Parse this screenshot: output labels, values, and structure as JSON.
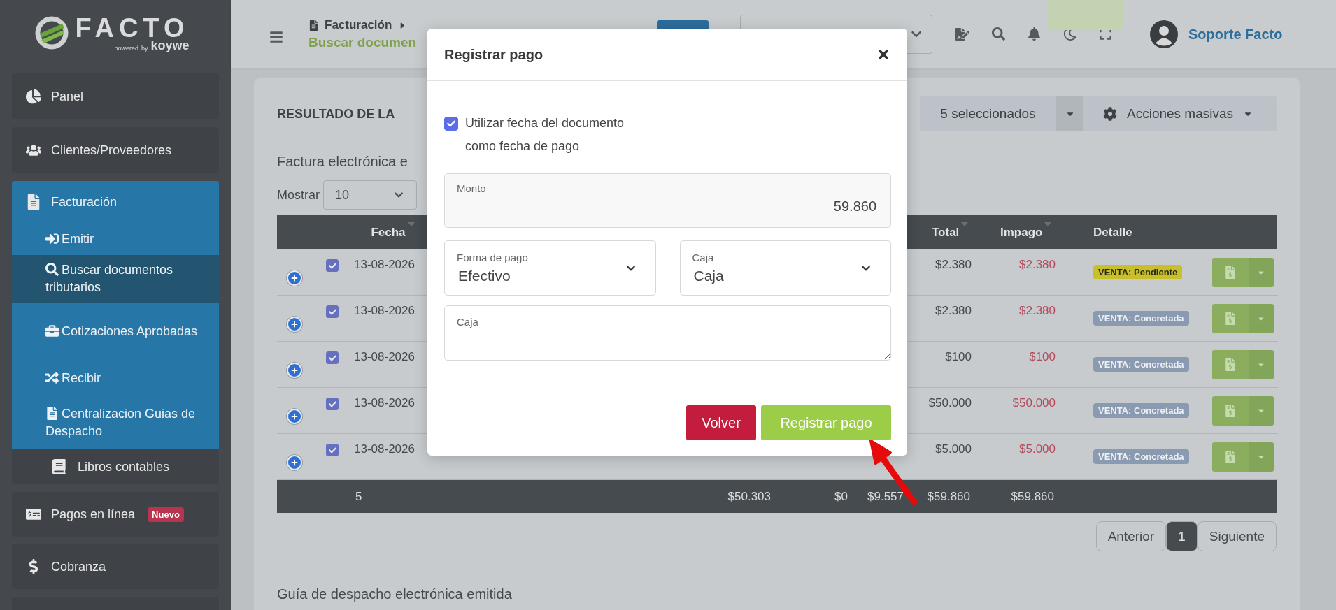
{
  "sidebar": {
    "logo": {
      "name": "FACTO",
      "powered": "powered",
      "by": "by",
      "brand": "koywe"
    },
    "items": [
      {
        "label": "Panel",
        "kind": "link"
      },
      {
        "label": "Clientes/Proveedores",
        "kind": "link"
      },
      {
        "label": "Facturación",
        "kind": "group",
        "expanded": true,
        "children": [
          {
            "label": "Emitir",
            "selected": false
          },
          {
            "label": "Buscar documentos tributarios",
            "selected": true
          },
          {
            "label": "Cotizaciones Aprobadas",
            "selected": false
          },
          {
            "label": "Recibir",
            "selected": false
          },
          {
            "label": "Centralizacion Guias de Despacho",
            "selected": false
          }
        ]
      },
      {
        "label": "Libros contables",
        "kind": "sublink"
      },
      {
        "label": "Pagos en línea",
        "kind": "link",
        "badge": "Nuevo"
      },
      {
        "label": "Cobranza",
        "kind": "link"
      }
    ]
  },
  "header": {
    "breadcrumb": {
      "section": "Facturación",
      "page": "Buscar documen"
    },
    "user": {
      "name": "Soporte Facto"
    }
  },
  "content": {
    "title": "RESULTADO DE LA",
    "selection": {
      "count_label": "5 seleccionados",
      "actions_label": "Acciones masivas"
    },
    "section_title": "Factura electrónica e",
    "show": {
      "label": "Mostrar",
      "value": "10"
    },
    "table": {
      "columns": [
        "Fecha",
        "Total",
        "Impago",
        "Detalle"
      ],
      "rows": [
        {
          "checked": true,
          "fecha": "13-08-2026",
          "total": "$2.380",
          "impago": "$2.380",
          "status": {
            "label": "VENTA: Pendiente",
            "color": "#c8bf2a"
          }
        },
        {
          "checked": true,
          "fecha": "13-08-2026",
          "total": "$2.380",
          "impago": "$2.380",
          "status": {
            "label": "VENTA: Concretada",
            "color": "#8a9ab0"
          }
        },
        {
          "checked": true,
          "fecha": "13-08-2026",
          "total": "$100",
          "impago": "$100",
          "status": {
            "label": "VENTA: Concretada",
            "color": "#8a9ab0"
          }
        },
        {
          "checked": true,
          "fecha": "13-08-2026",
          "total": "$50.000",
          "impago": "$50.000",
          "status": {
            "label": "VENTA: Concretada",
            "color": "#8a9ab0"
          }
        },
        {
          "checked": true,
          "fecha": "13-08-2026",
          "total": "$5.000",
          "impago": "$5.000",
          "status": {
            "label": "VENTA: Concretada",
            "color": "#8a9ab0"
          }
        }
      ],
      "footer": {
        "count": "5",
        "values": [
          "$50.303",
          "$0",
          "$9.557",
          "$59.860",
          "$59.860"
        ]
      }
    },
    "pagination": {
      "previous": "Anterior",
      "pages": [
        {
          "label": "1",
          "selected": true
        }
      ],
      "next": "Siguiente"
    },
    "next_section": "Guía de despacho electrónica emitida"
  },
  "modal": {
    "title": "Registrar pago",
    "use_doc_date": {
      "label": "Utilizar fecha del documento como fecha de pago",
      "checked": true
    },
    "amount": {
      "label": "Monto",
      "value": "59.860"
    },
    "method": {
      "label": "Forma de pago",
      "value": "Efectivo"
    },
    "cashbox": {
      "label": "Caja",
      "value": "Caja"
    },
    "notes": {
      "placeholder": "Caja"
    },
    "buttons": {
      "back": "Volver",
      "submit": "Registrar pago"
    }
  }
}
